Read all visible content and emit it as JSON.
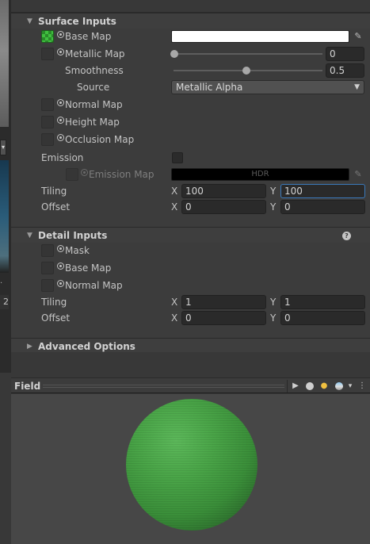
{
  "left_strip": {
    "dropdown_glyph": "▾",
    "number": "2",
    "dot": "·"
  },
  "surface_inputs": {
    "title": "Surface Inputs",
    "base_map": {
      "label": "Base Map",
      "color": "#ffffff"
    },
    "metallic_map": {
      "label": "Metallic Map",
      "value": "0",
      "slider": 0.0
    },
    "smoothness": {
      "label": "Smoothness",
      "value": "0.5",
      "slider": 0.5
    },
    "source": {
      "label": "Source",
      "value": "Metallic Alpha"
    },
    "normal_map": {
      "label": "Normal Map"
    },
    "height_map": {
      "label": "Height Map"
    },
    "occlusion_map": {
      "label": "Occlusion Map"
    },
    "emission": {
      "label": "Emission",
      "checked": false
    },
    "emission_map": {
      "label": "Emission Map",
      "hdr_label": "HDR"
    },
    "tiling": {
      "label": "Tiling",
      "x_axis": "X",
      "y_axis": "Y",
      "x": "100",
      "y": "100"
    },
    "offset": {
      "label": "Offset",
      "x_axis": "X",
      "y_axis": "Y",
      "x": "0",
      "y": "0"
    }
  },
  "detail_inputs": {
    "title": "Detail Inputs",
    "help_glyph": "?",
    "mask": {
      "label": "Mask"
    },
    "base_map": {
      "label": "Base Map"
    },
    "normal_map": {
      "label": "Normal Map"
    },
    "tiling": {
      "label": "Tiling",
      "x_axis": "X",
      "y_axis": "Y",
      "x": "1",
      "y": "1"
    },
    "offset": {
      "label": "Offset",
      "x_axis": "X",
      "y_axis": "Y",
      "x": "0",
      "y": "0"
    }
  },
  "advanced_options": {
    "title": "Advanced Options"
  },
  "preview": {
    "title": "Field",
    "play_glyph": "▶",
    "menu_glyph": "⋮",
    "dropdown_glyph": "▾",
    "sphere_color": "#4aa548"
  },
  "glyphs": {
    "expanded": "▼",
    "collapsed": "▶",
    "dropdown": "▼",
    "eyedropper": "✎"
  }
}
